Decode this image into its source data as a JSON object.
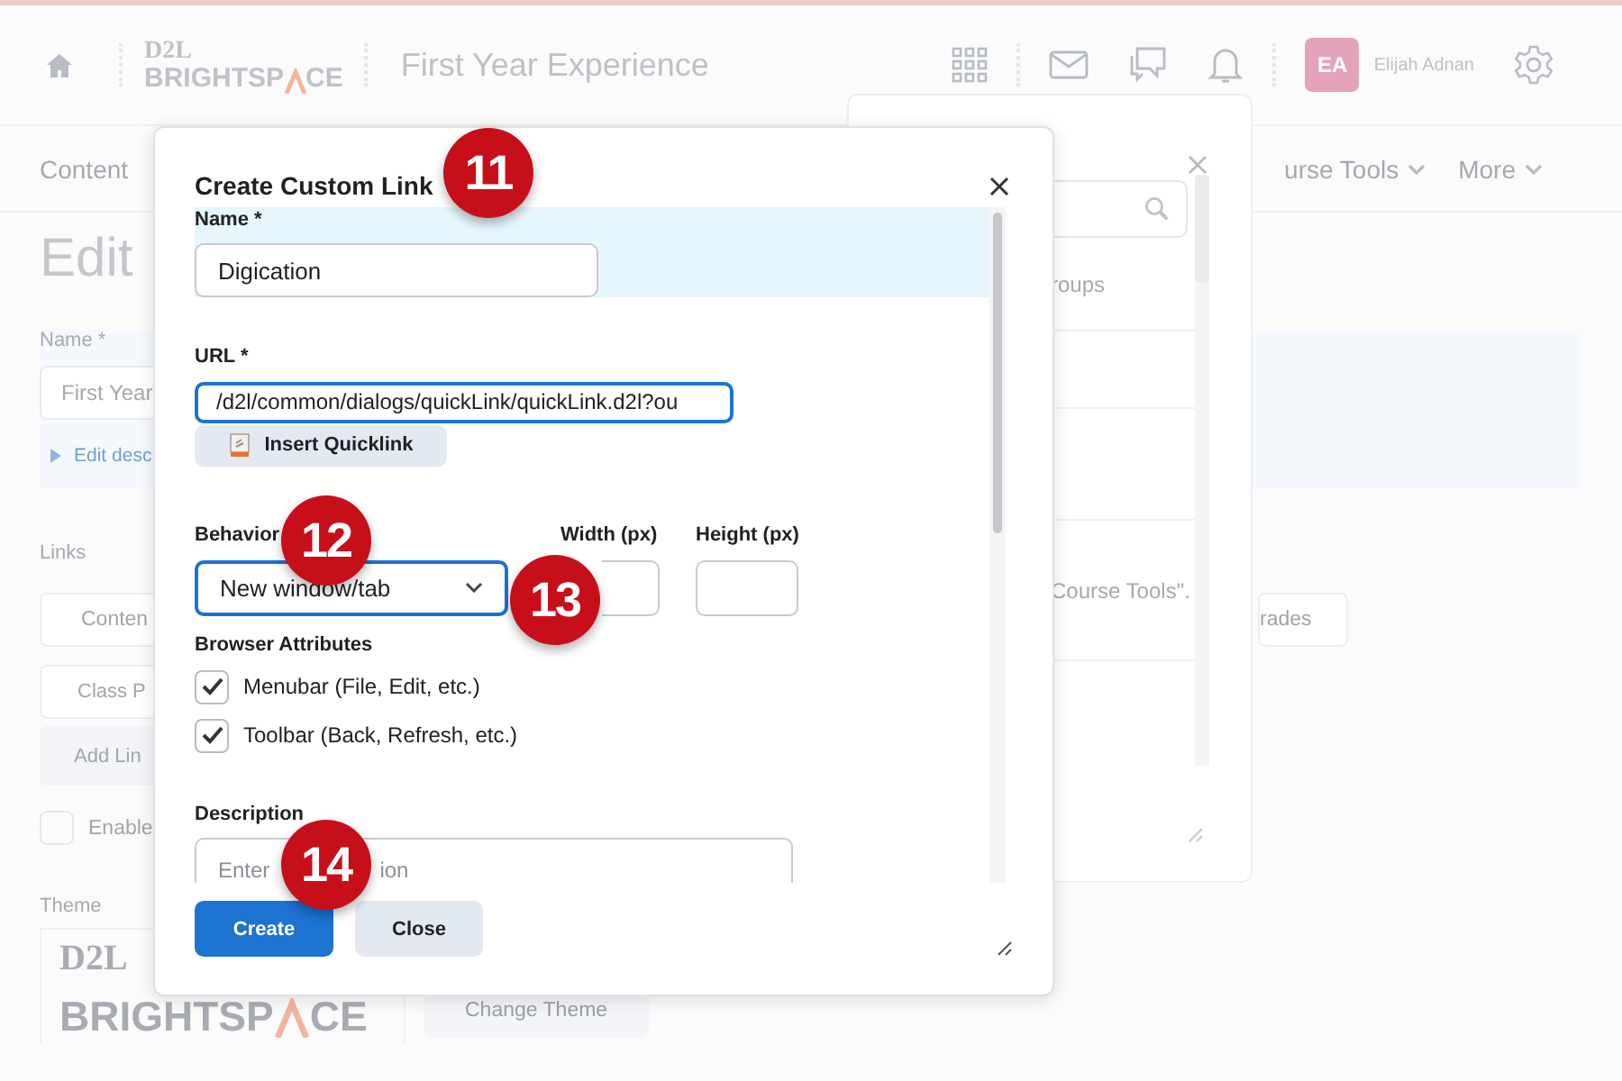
{
  "header": {
    "logo": {
      "top": "D2L",
      "left": "BRIGHTSP",
      "right": "CE"
    },
    "course_title": "First Year Experience",
    "avatar_initials": "EA",
    "user_name": "Elijah Adnan"
  },
  "nav": {
    "items": [
      {
        "label": "Content",
        "dropdown": false
      },
      {
        "label": "urse Tools",
        "dropdown": true
      },
      {
        "label": "More",
        "dropdown": true
      }
    ]
  },
  "page": {
    "title": "Edit",
    "name_label": "Name *",
    "name_value": "First Year",
    "edit_description": "Edit desc",
    "links_label": "Links",
    "link_buttons": [
      "Conten",
      "Class P"
    ],
    "right_button": "rades",
    "add_link": "Add Lin",
    "enable": {
      "label": "Enable",
      "checked": false
    },
    "theme_label": "Theme",
    "theme_logo": {
      "top": "D2L",
      "left": "BRIGHTSP",
      "right": "CE"
    },
    "change_theme": "Change Theme"
  },
  "back_dialog": {
    "tab": "roups",
    "note": "Course Tools\"."
  },
  "dialog": {
    "title": "Create Custom Link",
    "name": {
      "label": "Name *",
      "value": "Digication"
    },
    "url": {
      "label": "URL *",
      "value": "/d2l/common/dialogs/quickLink/quickLink.d2l?ou"
    },
    "insert_quicklink": "Insert Quicklink",
    "behavior": {
      "label": "Behavior",
      "value": "New window/tab"
    },
    "width_label": "Width (px)",
    "height_label": "Height (px)",
    "attributes_label": "Browser Attributes",
    "attributes": [
      {
        "label": "Menubar (File, Edit, etc.)",
        "checked": true
      },
      {
        "label": "Toolbar (Back, Refresh, etc.)",
        "checked": true
      }
    ],
    "description": {
      "label": "Description",
      "placeholder_fragments": [
        "Enter",
        "ion"
      ]
    },
    "buttons": [
      {
        "label": "Create",
        "primary": true
      },
      {
        "label": "Close",
        "primary": false
      }
    ]
  },
  "callouts": [
    "11",
    "12",
    "13",
    "14"
  ]
}
